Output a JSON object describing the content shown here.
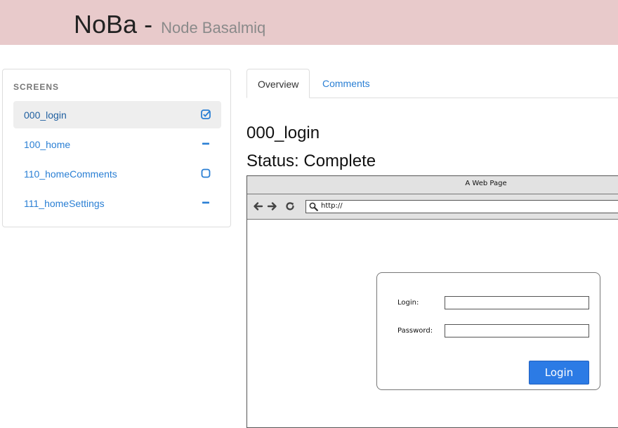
{
  "header": {
    "title": "NoBa",
    "separator": "-",
    "subtitle": "Node Basalmiq"
  },
  "sidebar": {
    "title": "SCREENS",
    "items": [
      {
        "label": "000_login",
        "status_icon": "checkbox-checked-icon"
      },
      {
        "label": "100_home",
        "status_icon": "minus-icon"
      },
      {
        "label": "110_homeComments",
        "status_icon": "checkbox-empty-icon"
      },
      {
        "label": "111_homeSettings",
        "status_icon": "minus-icon"
      }
    ]
  },
  "tabs": [
    {
      "label": "Overview",
      "active": true
    },
    {
      "label": "Comments",
      "active": false
    }
  ],
  "screen": {
    "name": "000_login",
    "status": "Status: Complete"
  },
  "mockup": {
    "window_title": "A Web Page",
    "url": "http://",
    "login_label": "Login:",
    "password_label": "Password:",
    "button_label": "Login"
  },
  "colors": {
    "header_bg": "#e8cacb",
    "link": "#2a7fd4",
    "login_button": "#2c7be5"
  }
}
